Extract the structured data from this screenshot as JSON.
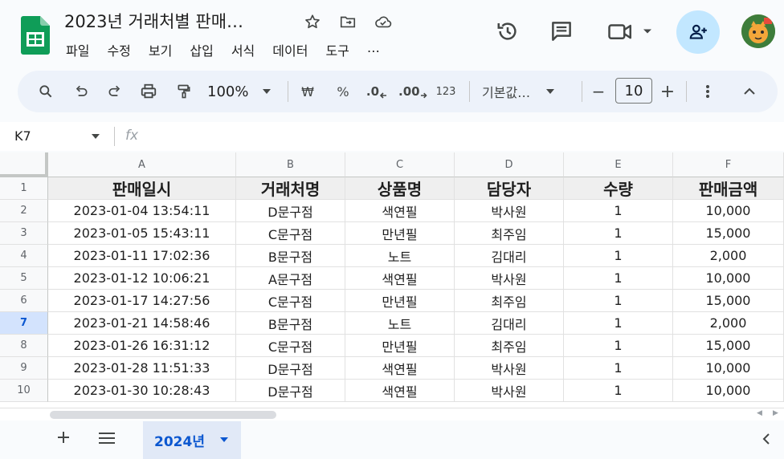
{
  "app": {
    "title": "2023년 거래처별 판매…",
    "menu": [
      "파일",
      "수정",
      "보기",
      "삽입",
      "서식",
      "데이터",
      "도구",
      "…"
    ]
  },
  "toolbar": {
    "zoom": "100%",
    "currency": "₩",
    "percent": "%",
    "dec_decrease": ".0",
    "dec_increase": ".00",
    "number_format": "123",
    "font": "기본값…",
    "font_size": "10",
    "minus": "−",
    "plus": "+"
  },
  "formula_bar": {
    "cell_ref": "K7",
    "fx": "fx"
  },
  "grid": {
    "columns": [
      "A",
      "B",
      "C",
      "D",
      "E",
      "F"
    ],
    "row_numbers": [
      "1",
      "2",
      "3",
      "4",
      "5",
      "6",
      "7",
      "8",
      "9",
      "10"
    ],
    "active_row": "7",
    "header_row": [
      "판매일시",
      "거래처명",
      "상품명",
      "담당자",
      "수량",
      "판매금액"
    ],
    "rows": [
      [
        "2023-01-04 13:54:11",
        "D문구점",
        "색연필",
        "박사원",
        "1",
        "10,000"
      ],
      [
        "2023-01-05 15:43:11",
        "C문구점",
        "만년필",
        "최주임",
        "1",
        "15,000"
      ],
      [
        "2023-01-11 17:02:36",
        "B문구점",
        "노트",
        "김대리",
        "1",
        "2,000"
      ],
      [
        "2023-01-12 10:06:21",
        "A문구점",
        "색연필",
        "박사원",
        "1",
        "10,000"
      ],
      [
        "2023-01-17 14:27:56",
        "C문구점",
        "만년필",
        "최주임",
        "1",
        "15,000"
      ],
      [
        "2023-01-21 14:58:46",
        "B문구점",
        "노트",
        "김대리",
        "1",
        "2,000"
      ],
      [
        "2023-01-26 16:31:12",
        "C문구점",
        "만년필",
        "최주임",
        "1",
        "15,000"
      ],
      [
        "2023-01-28 11:51:33",
        "D문구점",
        "색연필",
        "박사원",
        "1",
        "10,000"
      ],
      [
        "2023-01-30 10:28:43",
        "D문구점",
        "색연필",
        "박사원",
        "1",
        "10,000"
      ]
    ]
  },
  "sheets": {
    "active": "2024년"
  },
  "colors": {
    "accent": "#0b57d0",
    "share_bg": "#c2e7ff",
    "toolbar_bg": "#edf2fa",
    "sheets_green": "#0f9d58"
  }
}
